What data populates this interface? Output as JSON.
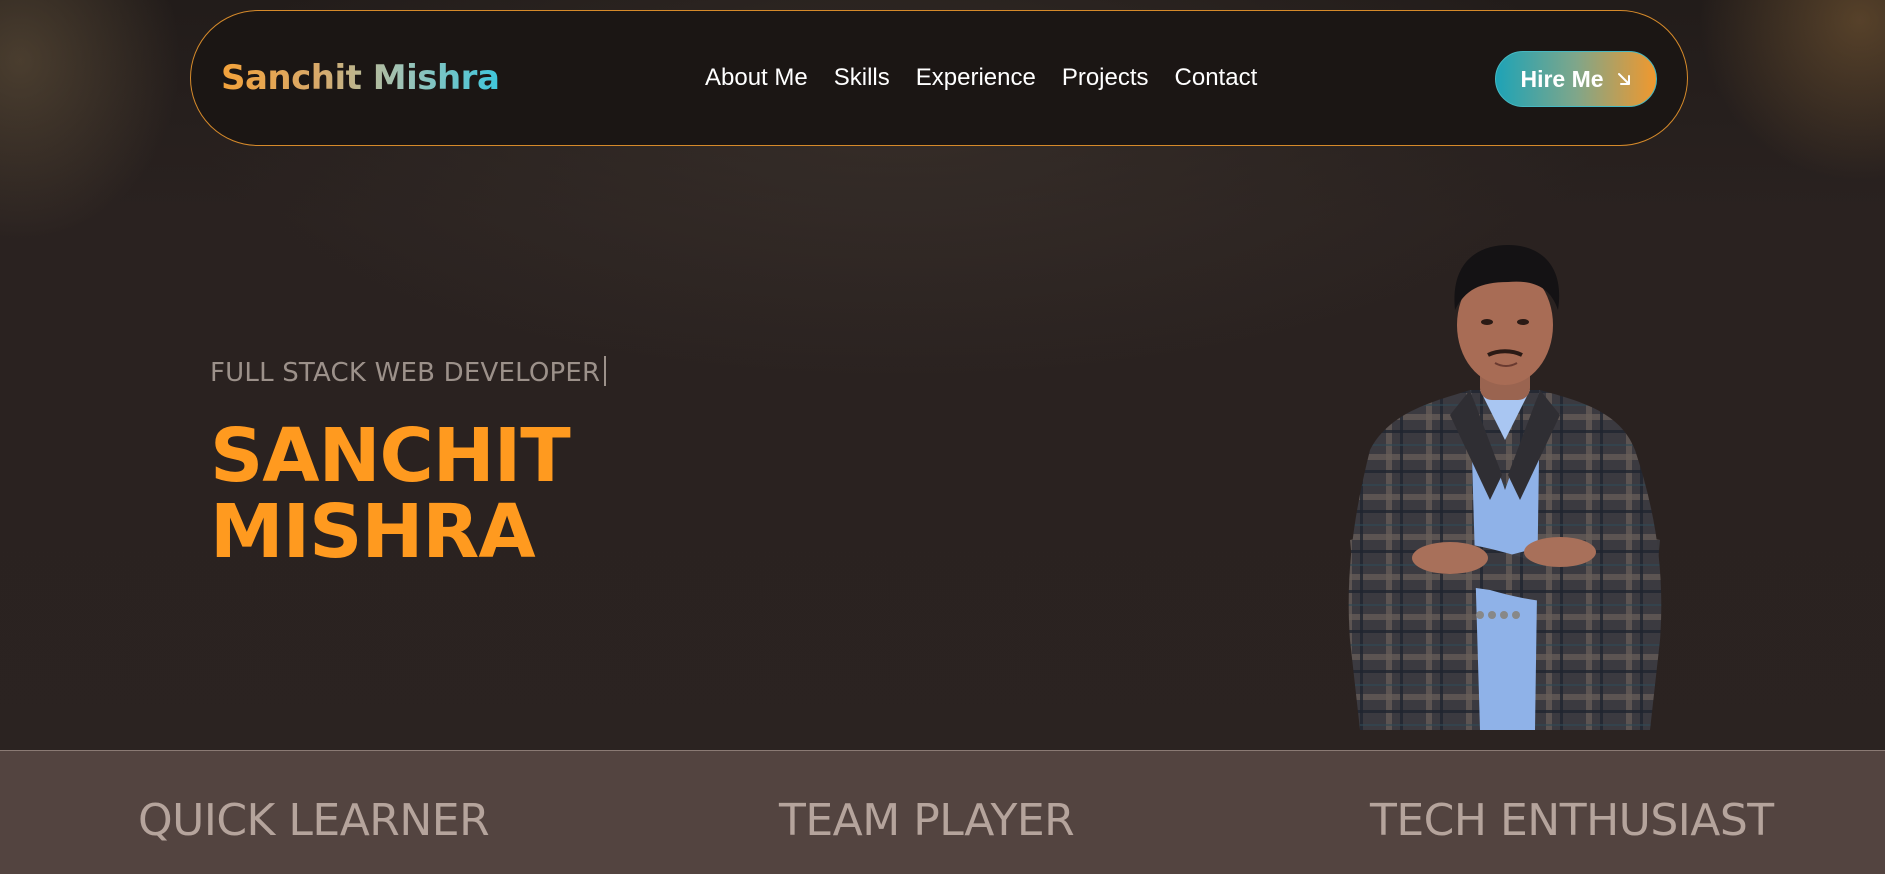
{
  "colors": {
    "background": "#2a2220",
    "navbar_border": "#d68a2a",
    "accent_orange": "#ff9a1f",
    "accent_teal": "#1ea3b6",
    "strip_background": "#534440",
    "muted_text": "#9c918a"
  },
  "navbar": {
    "brand": "Sanchit Mishra",
    "links": [
      {
        "label": "About Me"
      },
      {
        "label": "Skills"
      },
      {
        "label": "Experience"
      },
      {
        "label": "Projects"
      },
      {
        "label": "Contact"
      }
    ],
    "cta": {
      "label": "Hire Me",
      "icon": "arrow-down-right-icon"
    }
  },
  "hero": {
    "subtitle": "FULL STACK WEB DEVELOPER",
    "name_line1": "SANCHIT",
    "name_line2": "MISHRA",
    "portrait": "portrait-photo"
  },
  "traits": [
    {
      "label": "QUICK LEARNER"
    },
    {
      "label": "TEAM PLAYER"
    },
    {
      "label": "TECH ENTHUSIAST"
    }
  ]
}
